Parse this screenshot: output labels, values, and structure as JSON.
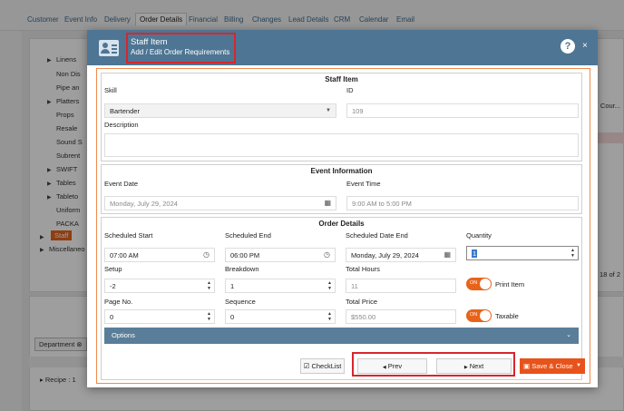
{
  "background": {
    "tabs": [
      "Customer",
      "Event Info",
      "Delivery",
      "Order Details",
      "Financial",
      "Billing",
      "Changes",
      "Lead Details",
      "CRM",
      "Calendar",
      "Email"
    ],
    "active_tab": "Order Details",
    "tree": [
      "Linens",
      "Non Dis",
      "Pipe an",
      "Platters",
      "Props",
      "Resale",
      "Sound S",
      "Subrent",
      "SWIFT",
      "Tables",
      "Tableto",
      "Uniform",
      "PACKA"
    ],
    "staff_label": "Staff",
    "misc_label": "Miscellaneo",
    "right_col": "Cour...",
    "pagination": "1 - 18 of 2",
    "department_chip": "Department",
    "recipe": "Recipe : 1"
  },
  "modal": {
    "title": "Staff Item",
    "subtitle": "Add / Edit Order Requirements",
    "help": "?",
    "close": "×",
    "staff_item": {
      "heading": "Staff Item",
      "skill_label": "Skill",
      "skill_value": "Bartender",
      "id_label": "ID",
      "id_value": "109",
      "description_label": "Description",
      "description_value": ""
    },
    "event_info": {
      "heading": "Event Information",
      "date_label": "Event Date",
      "date_value": "Monday, July 29, 2024",
      "time_label": "Event Time",
      "time_value": "9:00 AM to 5:00 PM"
    },
    "order_details": {
      "heading": "Order Details",
      "sched_start_label": "Scheduled Start",
      "sched_start_value": "07:00 AM",
      "sched_end_label": "Scheduled End",
      "sched_end_value": "06:00 PM",
      "sched_date_end_label": "Scheduled Date End",
      "sched_date_end_value": "Monday, July 29, 2024",
      "quantity_label": "Quantity",
      "quantity_value": "1",
      "setup_label": "Setup",
      "setup_value": "-2",
      "breakdown_label": "Breakdown",
      "breakdown_value": "1",
      "total_hours_label": "Total Hours",
      "total_hours_value": "11",
      "print_item_label": "Print Item",
      "page_no_label": "Page No.",
      "page_no_value": "0",
      "sequence_label": "Sequence",
      "sequence_value": "0",
      "total_price_label": "Total Price",
      "total_price_value": "$550.00",
      "taxable_label": "Taxable",
      "toggle_on": "ON"
    },
    "options_label": "Options",
    "footer": {
      "checklist": "CheckList",
      "prev": "Prev",
      "next": "Next",
      "save_close": "Save & Close"
    }
  }
}
